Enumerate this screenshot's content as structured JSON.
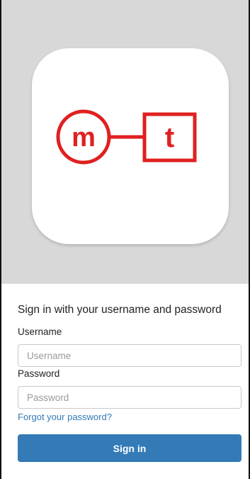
{
  "logo": {
    "letter_left": "m",
    "letter_right": "t",
    "brand_color": "#e02020",
    "tile_color": "#ffffff",
    "background_color": "#d8d8d8"
  },
  "form": {
    "heading": "Sign in with your username and password",
    "username_label": "Username",
    "username_placeholder": "Username",
    "username_value": "",
    "password_label": "Password",
    "password_placeholder": "Password",
    "password_value": "",
    "forgot_link": "Forgot your password?",
    "submit_label": "Sign in",
    "button_color": "#337ab7"
  }
}
